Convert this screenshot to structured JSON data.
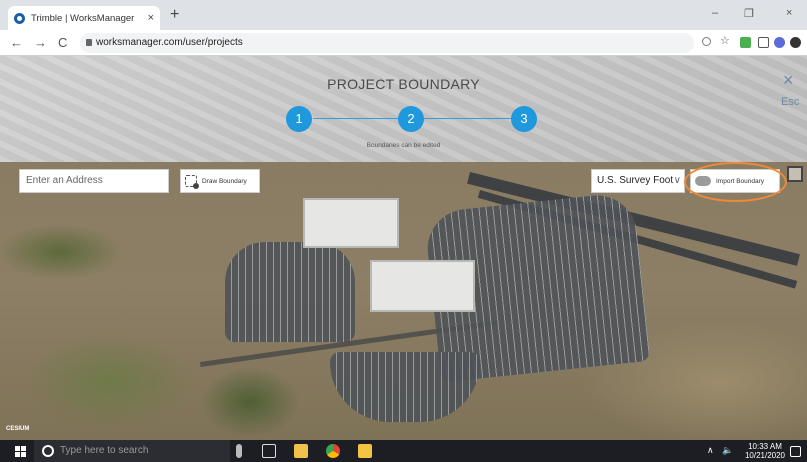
{
  "browser": {
    "tab_title": "Trimble | WorksManager",
    "tab_close": "×",
    "new_tab": "+",
    "url": "worksmanager.com/user/projects",
    "back": "←",
    "forward": "→",
    "reload": "C",
    "minimize": "–",
    "restore": "❐",
    "close": "×"
  },
  "page": {
    "title": "PROJECT BOUNDARY",
    "steps": [
      "1",
      "2",
      "3"
    ],
    "step_caption": "Boundaries can be edited",
    "close": "×",
    "esc": "Esc"
  },
  "toolbar": {
    "address_placeholder": "Enter an Address",
    "draw_boundary": "Draw Boundary",
    "units_selected": "U.S. Survey Foot",
    "units_chevron": "∨",
    "import_boundary": "Import Boundary"
  },
  "map": {
    "attribution": "CESIUM"
  },
  "taskbar": {
    "search_placeholder": "Type here to search",
    "time": "10:33 AM",
    "date": "10/21/2020",
    "tray_arrow": "∧",
    "volume": "🔈"
  }
}
